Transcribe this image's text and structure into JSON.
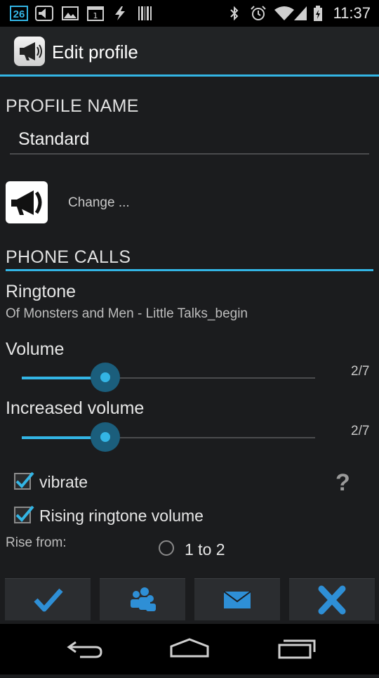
{
  "status_bar": {
    "badge": "26",
    "time": "11:37",
    "icons": [
      "speaker-notification-icon",
      "image-icon",
      "calendar-icon",
      "lightning-icon",
      "barcode-icon",
      "bluetooth-icon",
      "alarm-icon",
      "wifi-icon",
      "cell-signal-icon",
      "battery-icon"
    ]
  },
  "action_bar": {
    "title": "Edit profile",
    "icon": "megaphone-icon"
  },
  "profile_name": {
    "header": "PROFILE NAME",
    "value": "Standard"
  },
  "profile_icon": {
    "icon": "megaphone-icon",
    "change_label": "Change ..."
  },
  "phone_calls": {
    "header": "PHONE CALLS",
    "ringtone": {
      "title": "Ringtone",
      "summary": "Of Monsters and Men - Little Talks_begin"
    },
    "volume": {
      "title": "Volume",
      "value_text": "2/7",
      "level": 2,
      "max": 7
    },
    "increased_volume": {
      "title": "Increased volume",
      "value_text": "2/7",
      "level": 2,
      "max": 7
    },
    "vibrate": {
      "label": "vibrate",
      "checked": true
    },
    "help_label": "?",
    "rising": {
      "label": "Rising ringtone volume",
      "checked": true
    },
    "rise_from": {
      "label": "Rise from:",
      "option": "1 to 2",
      "selected": false
    }
  },
  "bottom_buttons": [
    "checkmark-icon",
    "people-icon",
    "envelope-icon",
    "close-icon"
  ],
  "nav_bar": [
    "back-icon",
    "home-icon",
    "recents-icon"
  ],
  "colors": {
    "accent": "#33b5e5",
    "background": "#1b1c1e",
    "confirm_icon": "#2e8fd6"
  }
}
